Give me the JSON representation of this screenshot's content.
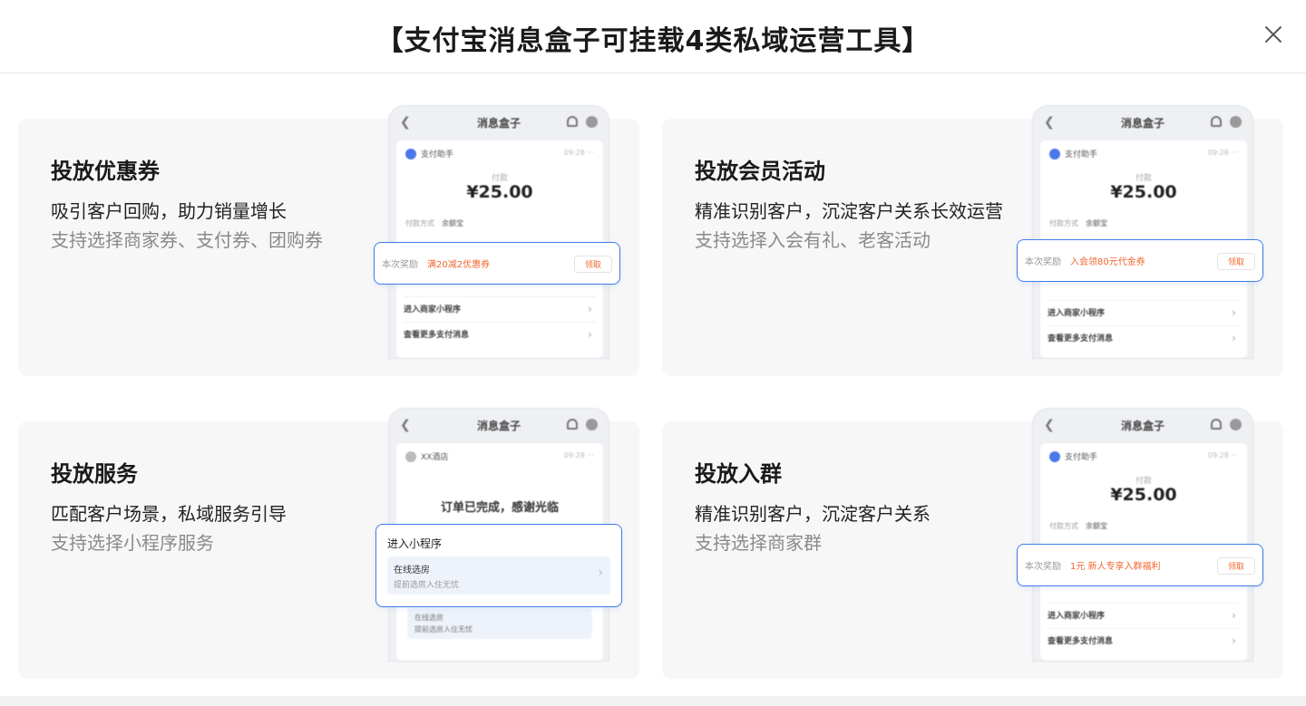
{
  "header": {
    "title": "【支付宝消息盒子可挂载4类私域运营工具】"
  },
  "phone_common": {
    "title": "消息盒子",
    "app_name": "支付助手",
    "time": "09:28  ···",
    "pay_label": "付款",
    "amount": "¥25.00",
    "pay_method_label": "付款方式",
    "pay_method_value": "余额宝",
    "link_1": "进入商家小程序",
    "link_2": "查看更多支付消息",
    "reward_label": "本次奖励",
    "claim_label": "领取"
  },
  "cards": [
    {
      "title": "投放优惠券",
      "subtitle": "吸引客户回购，助力销量增长",
      "note": "支持选择商家券、支付券、团购券",
      "reward": "满20减2优惠券"
    },
    {
      "title": "投放会员活动",
      "subtitle": "精准识别客户，沉淀客户关系长效运营",
      "note": "支持选择入会有礼、老客活动",
      "reward": "入会领80元代金券"
    },
    {
      "title": "投放服务",
      "subtitle": "匹配客户场景，私域服务引导",
      "note": "支持选择小程序服务",
      "phone_app_name": "XX酒店",
      "order_done": "订单已完成，感谢光临",
      "mini_heading": "进入小程序",
      "mini_item_title": "在线选房",
      "mini_item_desc": "提前选房入住无忧"
    },
    {
      "title": "投放入群",
      "subtitle": "精准识别客户，沉淀客户关系",
      "note": "支持选择商家群",
      "reward": "1元 新人专享入群福利"
    }
  ],
  "colors": {
    "accent_blue": "#3f7de8",
    "reward_orange": "#f0672f",
    "card_bg": "#f7f7f8"
  }
}
